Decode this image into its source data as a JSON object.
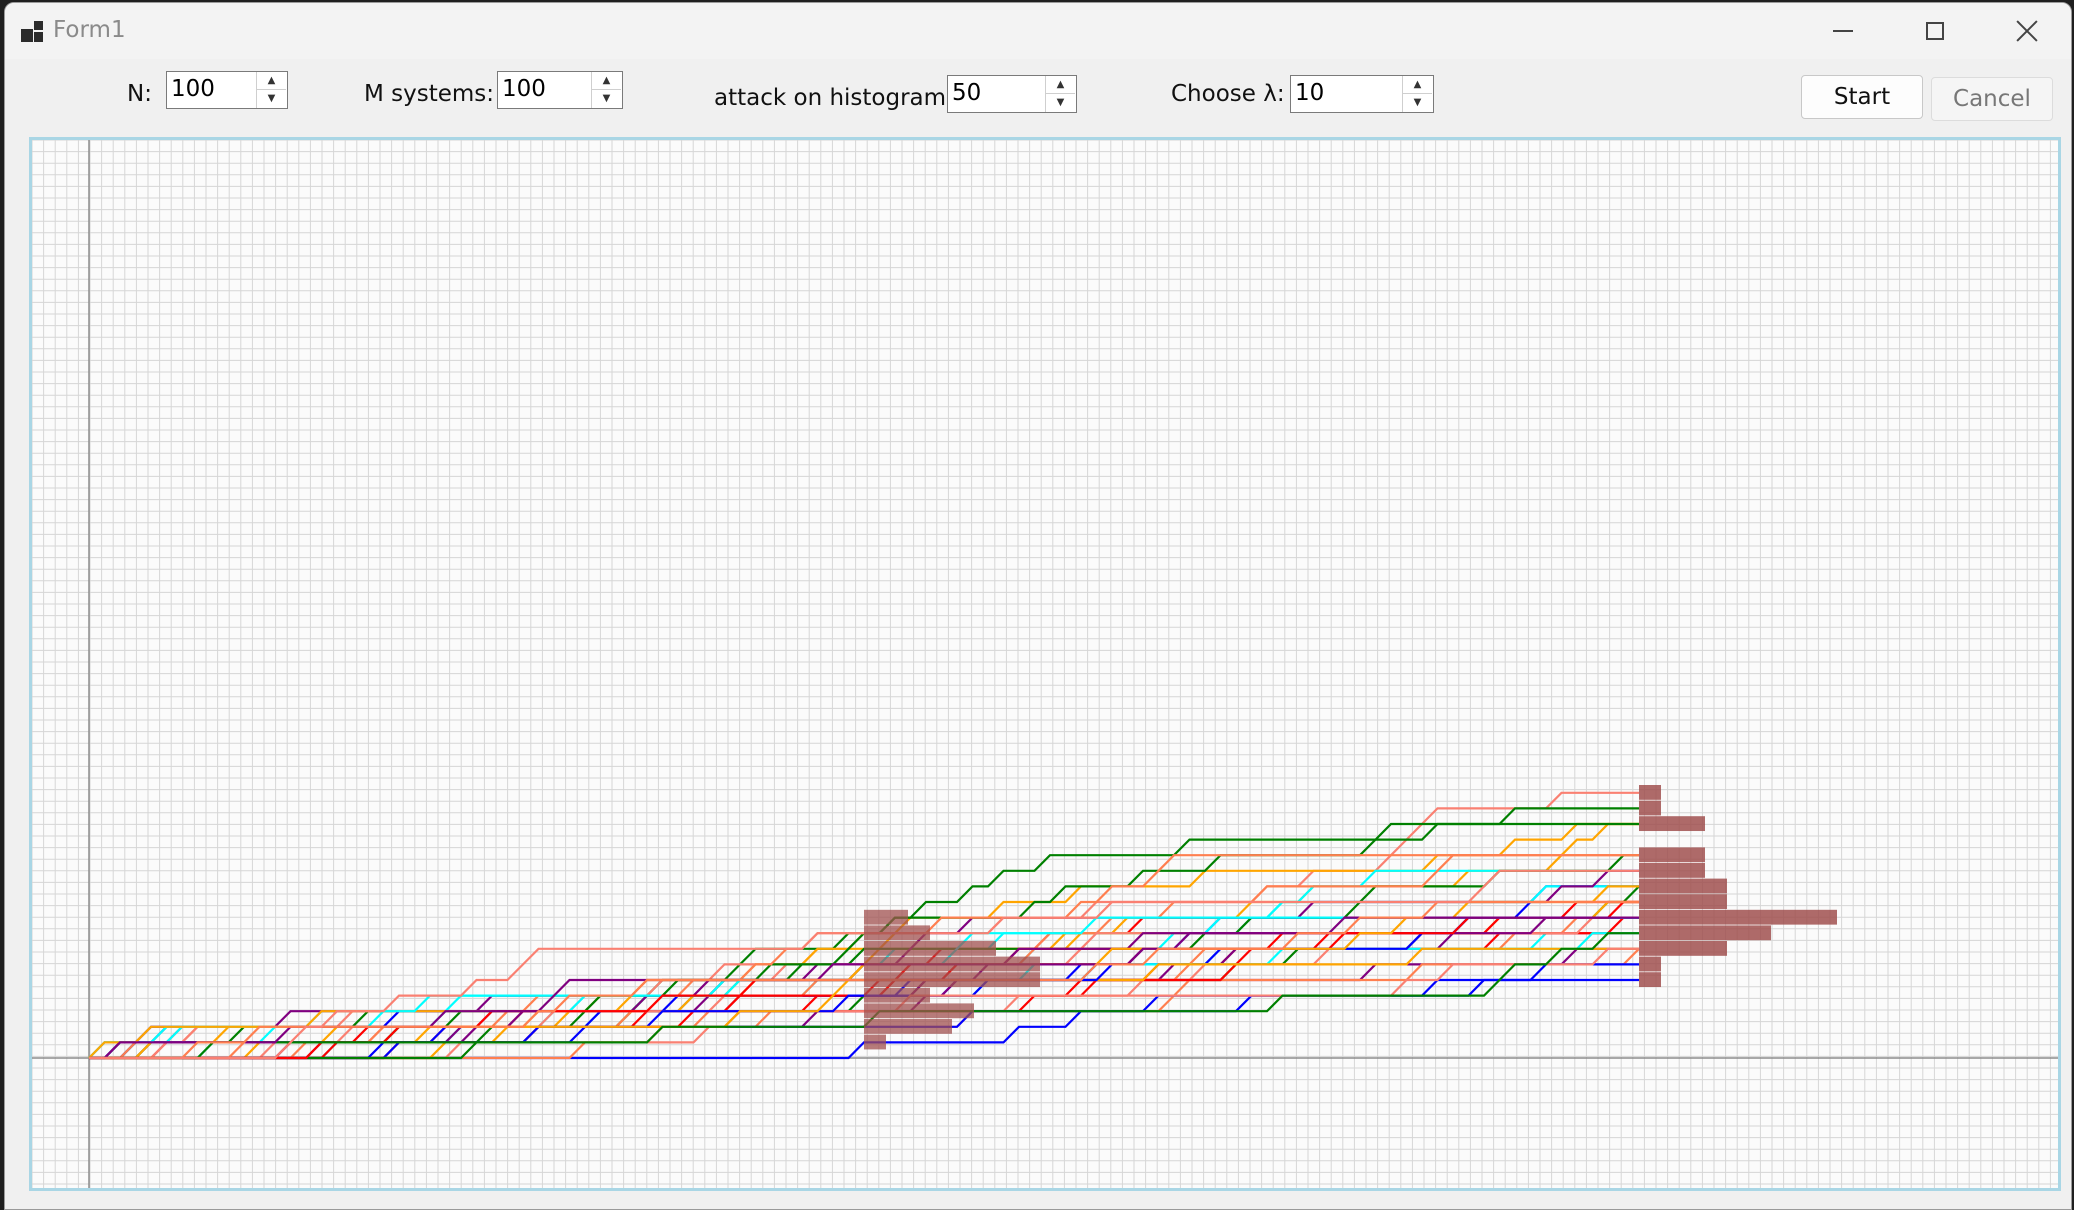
{
  "window": {
    "title": "Form1"
  },
  "controls": {
    "n_label": "N:",
    "n_value": "100",
    "m_label": "M systems:",
    "m_value": "100",
    "attack_label": "attack on histogram",
    "attack_value": "50",
    "lambda_label": "Choose λ:",
    "lambda_value": "10",
    "start_label": "Start",
    "cancel_label": "Cancel"
  },
  "plot": {
    "grid_on": true,
    "histogram_color": "#a0504f",
    "series_colors": [
      "#0000ff",
      "#00ffff",
      "#ff0000",
      "#ffa500",
      "#008000",
      "#800080",
      "#ff7f50",
      "#fa8072"
    ]
  }
}
